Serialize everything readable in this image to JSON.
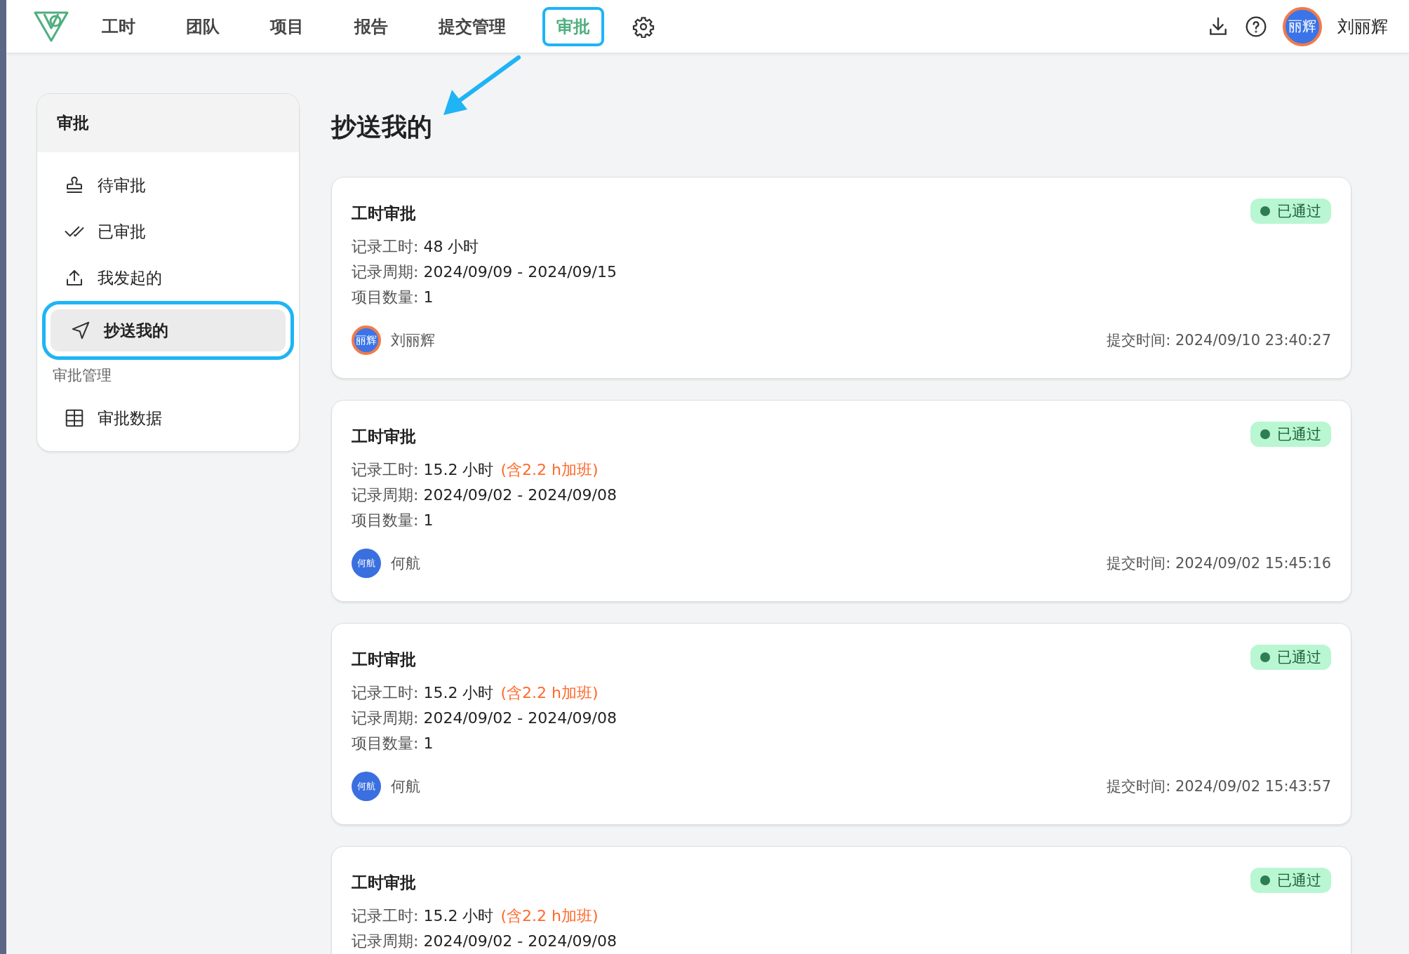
{
  "header": {
    "nav": [
      {
        "label": "工时",
        "selected": false,
        "highlighted": false
      },
      {
        "label": "团队",
        "selected": false,
        "highlighted": false
      },
      {
        "label": "项目",
        "selected": false,
        "highlighted": false
      },
      {
        "label": "报告",
        "selected": false,
        "highlighted": false
      },
      {
        "label": "提交管理",
        "selected": false,
        "highlighted": false
      },
      {
        "label": "审批",
        "selected": true,
        "highlighted": true
      }
    ],
    "user": {
      "avatar_text": "丽辉",
      "name": "刘丽辉"
    }
  },
  "sidebar": {
    "title": "审批",
    "items": [
      {
        "kind": "item",
        "label": "待审批",
        "selected": false,
        "highlighted": false
      },
      {
        "kind": "item",
        "label": "已审批",
        "selected": false,
        "highlighted": false
      },
      {
        "kind": "item",
        "label": "我发起的",
        "selected": false,
        "highlighted": false
      },
      {
        "kind": "item",
        "label": "抄送我的",
        "selected": true,
        "highlighted": true
      },
      {
        "kind": "section",
        "label": "审批管理"
      },
      {
        "kind": "item",
        "label": "审批数据",
        "selected": false,
        "highlighted": false
      }
    ]
  },
  "content": {
    "title": "抄送我的",
    "cards": [
      {
        "title": "工时审批",
        "status": "已通过",
        "fields": [
          {
            "label": "记录工时:",
            "value": "48 小时"
          },
          {
            "label": "记录周期:",
            "value": "2024/09/09 - 2024/09/15"
          },
          {
            "label": "项目数量:",
            "value": "1"
          }
        ],
        "submitter": {
          "kind": "image",
          "avatar_text": "丽辉",
          "name": "刘丽辉"
        },
        "submit_label": "提交时间:",
        "submit_time": "2024/09/10 23:40:27"
      },
      {
        "title": "工时审批",
        "status": "已通过",
        "fields": [
          {
            "label": "记录工时:",
            "value": "15.2 小时",
            "note": "(含2.2 h加班)"
          },
          {
            "label": "记录周期:",
            "value": "2024/09/02 - 2024/09/08"
          },
          {
            "label": "项目数量:",
            "value": "1"
          }
        ],
        "submitter": {
          "kind": "initials",
          "avatar_text": "何航",
          "name": "何航"
        },
        "submit_label": "提交时间:",
        "submit_time": "2024/09/02 15:45:16"
      },
      {
        "title": "工时审批",
        "status": "已通过",
        "fields": [
          {
            "label": "记录工时:",
            "value": "15.2 小时",
            "note": "(含2.2 h加班)"
          },
          {
            "label": "记录周期:",
            "value": "2024/09/02 - 2024/09/08"
          },
          {
            "label": "项目数量:",
            "value": "1"
          }
        ],
        "submitter": {
          "kind": "initials",
          "avatar_text": "何航",
          "name": "何航"
        },
        "submit_label": "提交时间:",
        "submit_time": "2024/09/02 15:43:57"
      },
      {
        "title": "工时审批",
        "status": "已通过",
        "fields": [
          {
            "label": "记录工时:",
            "value": "15.2 小时",
            "note": "(含2.2 h加班)"
          },
          {
            "label": "记录周期:",
            "value": "2024/09/02 - 2024/09/08"
          }
        ]
      }
    ]
  }
}
